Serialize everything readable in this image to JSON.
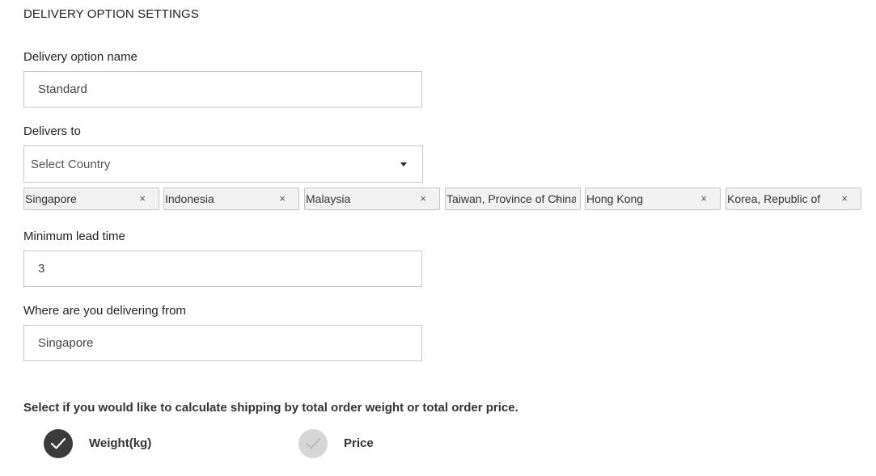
{
  "section_title": "DELIVERY OPTION SETTINGS",
  "delivery_option_name": {
    "label": "Delivery option name",
    "value": "Standard"
  },
  "delivers_to": {
    "label": "Delivers to",
    "placeholder": "Select Country",
    "selected": [
      {
        "label": "Singapore",
        "remove": "×"
      },
      {
        "label": "Indonesia",
        "remove": "×"
      },
      {
        "label": "Malaysia",
        "remove": "×"
      },
      {
        "label": "Taiwan, Province of China",
        "remove": "×"
      },
      {
        "label": "Hong Kong",
        "remove": "×"
      },
      {
        "label": "Korea, Republic of",
        "remove": "×"
      }
    ]
  },
  "minimum_lead_time": {
    "label": "Minimum lead time",
    "value": "3"
  },
  "delivering_from": {
    "label": "Where are you delivering from",
    "value": "Singapore"
  },
  "shipping_calc": {
    "instruction": "Select if you would like to calculate shipping by total order weight or total order price.",
    "options": [
      {
        "label": "Weight(kg)",
        "selected": true
      },
      {
        "label": "Price",
        "selected": false
      }
    ]
  },
  "colors": {
    "radio_on": "#3b3b3b",
    "radio_off": "#d6d6d6",
    "border": "#c6c6c6",
    "tag_bg": "#f2f2f2"
  }
}
